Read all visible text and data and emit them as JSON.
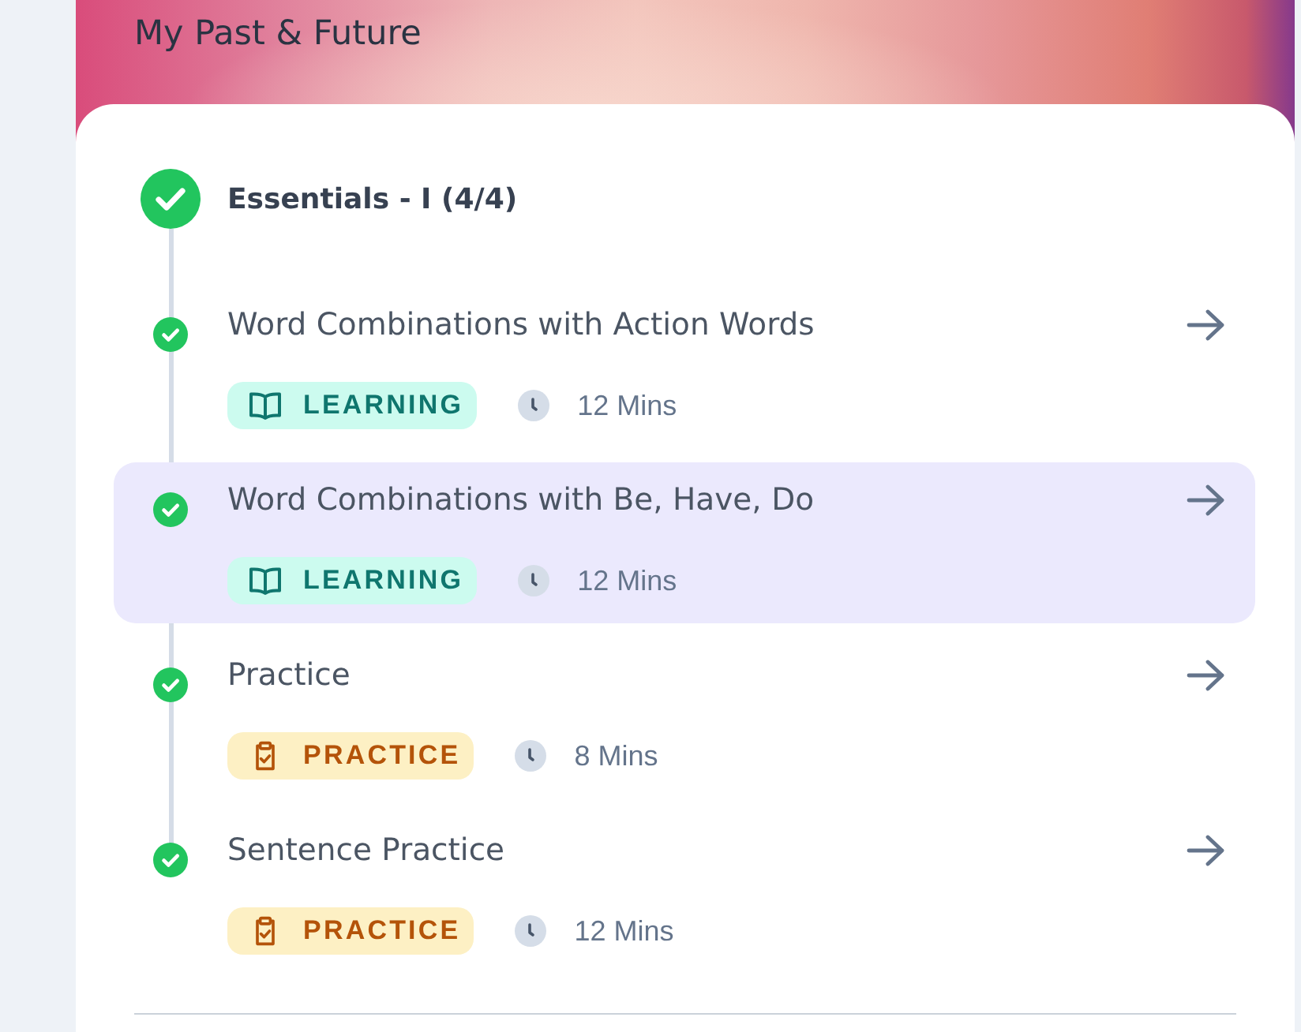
{
  "header": {
    "title": "My Past & Future"
  },
  "section": {
    "title": "Essentials - I (4/4)",
    "completed": true,
    "lessons": [
      {
        "title": "Word Combinations with Action Words",
        "kind": "learning",
        "tag": "LEARNING",
        "duration": "12 Mins",
        "completed": true,
        "selected": false
      },
      {
        "title": "Word Combinations with Be, Have, Do",
        "kind": "learning",
        "tag": "LEARNING",
        "duration": "12 Mins",
        "completed": true,
        "selected": true
      },
      {
        "title": "Practice",
        "kind": "practice",
        "tag": "PRACTICE",
        "duration": "8 Mins",
        "completed": true,
        "selected": false
      },
      {
        "title": "Sentence Practice",
        "kind": "practice",
        "tag": "PRACTICE",
        "duration": "12 Mins",
        "completed": true,
        "selected": false
      }
    ]
  }
}
